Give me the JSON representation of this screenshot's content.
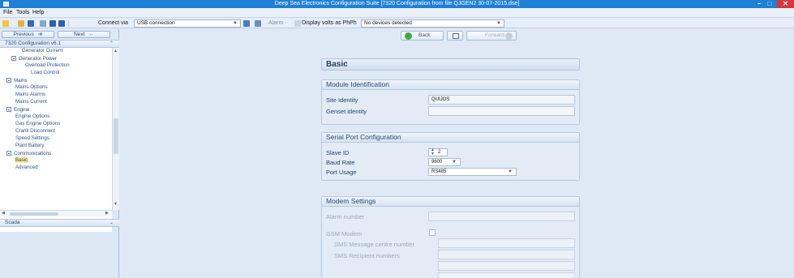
{
  "window": {
    "title": "Deep Sea Electronics Configuration Suite [7320 Configuration from file QJGEN2 30-07-2015.dse]",
    "minimize": "–",
    "maximize": "□",
    "close": "✕"
  },
  "menu": {
    "file": "File",
    "tools": "Tools",
    "help": "Help"
  },
  "toolbar": {
    "connect_label": "Connect via",
    "connection": "USB connection",
    "alarm_label": "Alarm -",
    "display_volts_label": "Display volts as PhPh",
    "devices": "No devices detected"
  },
  "sidebar": {
    "previous": "Previous",
    "next": "Next",
    "tree_title": "7320 Configuration v6.1",
    "items": [
      {
        "label": "Generator Current",
        "level": 2
      },
      {
        "label": "Generator Power",
        "level": 1,
        "expanded": true
      },
      {
        "label": "Overload Protection",
        "level": 3
      },
      {
        "label": "Load Control",
        "level": 3
      },
      {
        "label": "Mains",
        "level": 0,
        "expanded": true
      },
      {
        "label": "Mains Options",
        "level": 2
      },
      {
        "label": "Mains Alarms",
        "level": 2
      },
      {
        "label": "Mains Current",
        "level": 2
      },
      {
        "label": "Engine",
        "level": 0,
        "expanded": true
      },
      {
        "label": "Engine Options",
        "level": 2
      },
      {
        "label": "Gas Engine Options",
        "level": 2
      },
      {
        "label": "Crank Disconnect",
        "level": 2
      },
      {
        "label": "Speed Settings",
        "level": 2
      },
      {
        "label": "Plant Battery",
        "level": 2
      },
      {
        "label": "Communications",
        "level": 0,
        "expanded": true
      },
      {
        "label": "Basic",
        "level": 2,
        "selected": true
      },
      {
        "label": "Advanced",
        "level": 2
      }
    ],
    "scada": "Scada"
  },
  "nav": {
    "back": "Back",
    "forward": "Forward"
  },
  "page": {
    "title": "Basic",
    "module": {
      "title": "Module Identification",
      "site_identity_label": "Site Identity",
      "site_identity_value": "QUIJOS",
      "genset_identity_label": "Genset identity",
      "genset_identity_value": ""
    },
    "serial": {
      "title": "Serial Port Configuration",
      "slave_id_label": "Slave ID",
      "slave_id_value": "2",
      "baud_rate_label": "Baud Rate",
      "baud_rate_value": "9600",
      "port_usage_label": "Port Usage",
      "port_usage_value": "RS485"
    },
    "modem": {
      "title": "Modem Settings",
      "alarm_number_label": "Alarm number",
      "gsm_modem_label": "GSM Modem",
      "sms_centre_label": "SMS Message centre number",
      "sms_recipients_label": "SMS Recipient numbers"
    }
  },
  "colors": {
    "titlebar": "#1f7fd6",
    "close": "#d9383a",
    "selection": "#fbe8a6"
  }
}
